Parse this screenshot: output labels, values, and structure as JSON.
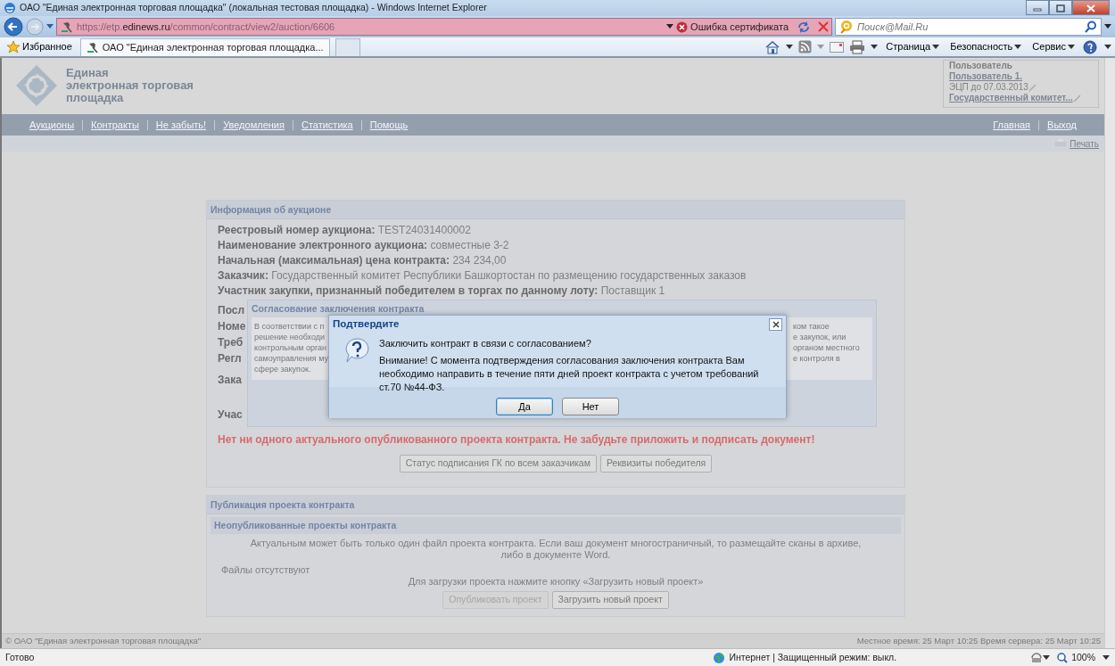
{
  "window": {
    "title": "ОАО \"Единая электронная торговая площадка\" (локальная тестовая площадка) - Windows Internet Explorer"
  },
  "address_bar": {
    "url": "https://etp.**edinews.ru**/common/contract/view2/auction/6606",
    "certificate_error": "Ошибка сертификата"
  },
  "search": {
    "placeholder": "Поиск@Mail.Ru"
  },
  "favorites_bar": {
    "favorites": "Избранное",
    "tabs": [
      {
        "label": "ОАО \"Единая электронная торговая площадка...",
        "selected": true
      }
    ],
    "commands": [
      "Страница",
      "Безопасность",
      "Сервис"
    ]
  },
  "site_header": {
    "logo_lines": [
      "Единая",
      "электронная торговая",
      "площадка"
    ],
    "user_box": {
      "legend": "Пользователь",
      "user": "Пользователь 1.",
      "certificate": "ЭЦП до 07.03.2013",
      "organization": "Государственный комитет..."
    }
  },
  "nav": {
    "left": [
      "Аукционы",
      "Контракты",
      "Не забыть!",
      "Уведомления",
      "Статистика",
      "Помощь"
    ],
    "right": [
      "Главная",
      "Выход"
    ]
  },
  "print": "Печать",
  "auction_panel": {
    "title": "Информация об аукционе",
    "rows": [
      "**Реестровый номер аукциона:** TEST24031400002",
      "**Наименование электронного аукциона:** совместные 3-2",
      "**Начальная (максимальная) цена контракта:** 234 234,00",
      "**Заказчик:** Государственный комитет Республики Башкортостан по размещению государственных заказов",
      "**Участник закупки, признанный победителем в торгах по данному лоту:** Поставщик 1"
    ],
    "covered_labels": [
      "Посл",
      "Номе",
      "Треб",
      "Регл",
      "Зака",
      "Учас"
    ],
    "warning": "Нет ни одного актуального опубликованного проекта контракта. Не забудьте приложить и подписать документ!",
    "buttons": [
      "Статус подписания ГК по всем заказчикам",
      "Реквизиты победителя"
    ]
  },
  "approval_dialog": {
    "title": "Согласование заключения контракта",
    "left_lines": [
      "В соответствии с п",
      "решение необходи",
      "контрольным орган",
      "самоуправления му",
      "сфере закупок."
    ],
    "right_lines": [
      "ком такое",
      "е закупок, или",
      "органом местного",
      "е контроля в"
    ]
  },
  "confirm_dialog": {
    "title": "Подтвердите",
    "question": "Заключить контракт в связи с согласованием?",
    "message": "Внимание! С момента подтверждения согласования заключения контракта Вам необходимо направить в течение пяти дней проект контракта с учетом требований ст.70 №44-ФЗ.",
    "buttons": [
      {
        "label": "Да",
        "selected": true
      },
      {
        "label": "Нет",
        "selected": false
      }
    ]
  },
  "publication_panel": {
    "title": "Публикация проекта контракта",
    "subtitle": "Неопубликованные проекты контракта",
    "note": "Актуальным может быть только один файл проекта контракта. Если ваш документ многостраничный, то размещайте сканы в архиве, либо в документе Word.",
    "files": "Файлы отсутствуют",
    "hint": "Для загрузки проекта нажмите кнопку «Загрузить новый проект»",
    "buttons": [
      {
        "label": "Опубликовать проект",
        "disabled": true
      },
      {
        "label": "Загрузить новый проект",
        "disabled": false
      }
    ]
  },
  "footer": {
    "copyright": "© ОАО \"Единая электронная торговая площадка\"",
    "time": "Местное время: 25 Март 10:25 Время сервера: 25 Март 10:25"
  },
  "status_bar": {
    "status": "Готово",
    "zone": "Интернет | Защищенный режим: выкл.",
    "zoom": "100%"
  }
}
